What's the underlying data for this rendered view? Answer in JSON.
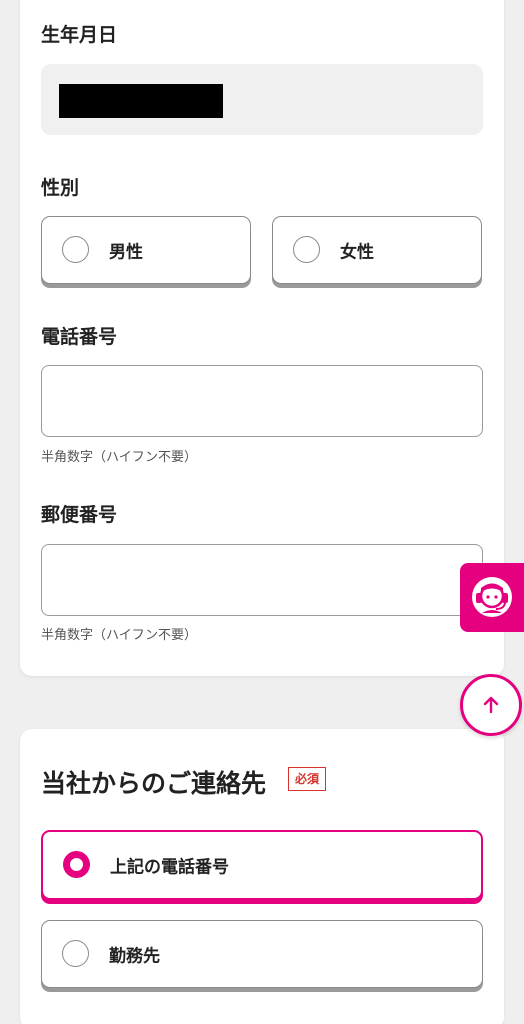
{
  "birthdate": {
    "label": "生年月日"
  },
  "gender": {
    "label": "性別",
    "options": [
      {
        "label": "男性",
        "selected": false
      },
      {
        "label": "女性",
        "selected": false
      }
    ]
  },
  "phone": {
    "label": "電話番号",
    "value": "",
    "hint": "半角数字（ハイフン不要）"
  },
  "postal": {
    "label": "郵便番号",
    "value": "",
    "hint": "半角数字（ハイフン不要）"
  },
  "contact": {
    "title": "当社からのご連絡先",
    "required_badge": "必須",
    "options": [
      {
        "label": "上記の電話番号",
        "selected": true
      },
      {
        "label": "勤務先",
        "selected": false
      }
    ]
  },
  "icons": {
    "support": "headset-support-icon",
    "scroll_top": "arrow-up-icon"
  },
  "colors": {
    "accent": "#e4007f",
    "required": "#d8332c",
    "page_bg": "#efefef"
  }
}
